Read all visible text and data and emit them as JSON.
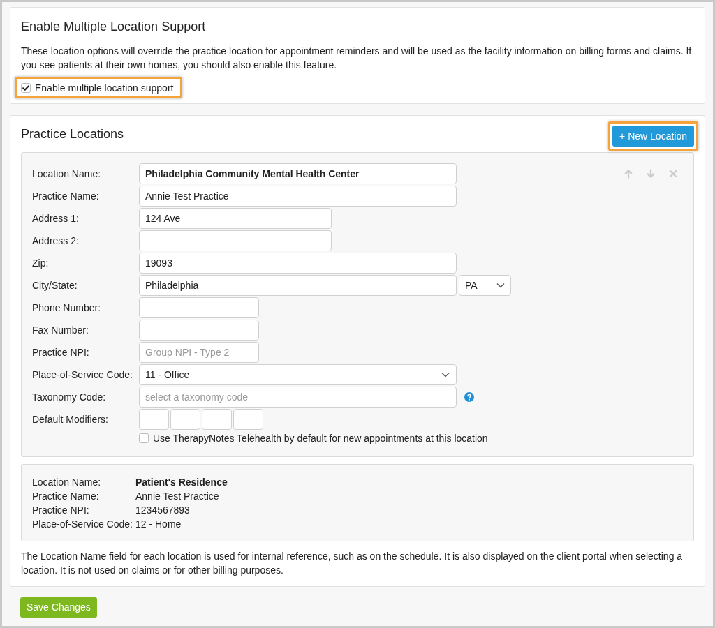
{
  "settings_card": {
    "title": "Enable Multiple Location Support",
    "description": "These location options will override the practice location for appointment reminders and will be used as the facility information on billing forms and claims. If you see patients at their own homes, you should also enable this feature.",
    "checkbox": {
      "label": "Enable multiple location support",
      "checked": true,
      "highlighted": true
    }
  },
  "locations_card": {
    "title": "Practice Locations",
    "new_button": {
      "label": "+ New Location",
      "highlighted": true
    },
    "locations": [
      {
        "kind": "editor",
        "fields": [
          {
            "kind": "name",
            "label": "Location Name:",
            "value": "Philadelphia Community Mental Health Center"
          },
          {
            "kind": "text",
            "label": "Practice Name:",
            "value": "Annie Test Practice"
          },
          {
            "kind": "text",
            "label": "Address 1:",
            "value": "124 Ave"
          },
          {
            "kind": "text",
            "label": "Address 2:"
          },
          {
            "kind": "text",
            "label": "Zip:",
            "value": "19093"
          },
          {
            "kind": "city_state",
            "label": "City/State:",
            "value": "Philadelphia",
            "state": "PA"
          },
          {
            "kind": "text",
            "label": "Phone Number:"
          },
          {
            "kind": "text",
            "label": "Fax Number:"
          },
          {
            "kind": "text",
            "label": "Practice NPI:",
            "placeholder": "Group NPI - Type 2"
          },
          {
            "kind": "select",
            "label": "Place-of-Service Code:",
            "value": "11 - Office"
          },
          {
            "kind": "lookup",
            "label": "Taxonomy Code:",
            "placeholder": "select a taxonomy code"
          },
          {
            "kind": "modifiers",
            "label": "Default Modifiers:"
          }
        ],
        "telehealth": {
          "label": "Use TherapyNotes Telehealth by default for new appointments at this location",
          "checked": false
        }
      },
      {
        "kind": "summary",
        "rows": [
          {
            "kind": "name",
            "label": "Location Name:",
            "value": "Patient's Residence"
          },
          {
            "kind": "text",
            "label": "Practice Name:",
            "value": "Annie Test Practice"
          },
          {
            "kind": "text",
            "label": "Practice NPI:",
            "value": "1234567893"
          },
          {
            "kind": "text",
            "label": "Place-of-Service Code:",
            "value": "12 - Home"
          }
        ]
      }
    ],
    "note": "The Location Name field for each location is used for internal reference, such as on the schedule. It is also displayed on the client portal when selecting a location. It is not used on claims or for other billing purposes."
  },
  "save_button": {
    "label": "Save Changes"
  }
}
